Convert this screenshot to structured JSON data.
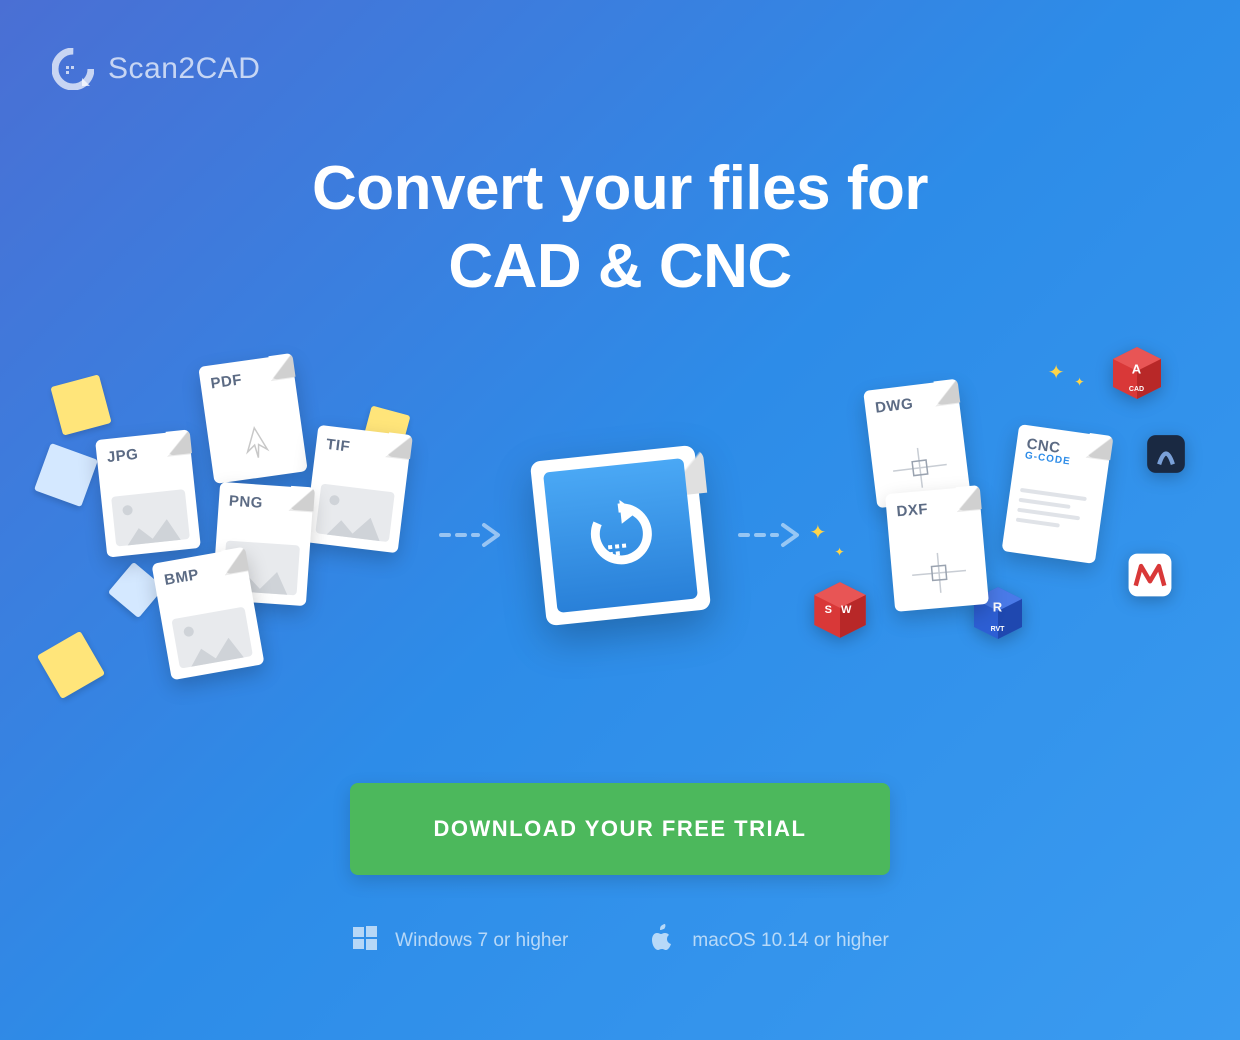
{
  "logo": {
    "text": "Scan2CAD"
  },
  "headline": "Convert your files for\nCAD & CNC",
  "input_files": [
    {
      "label": "PDF"
    },
    {
      "label": "TIF"
    },
    {
      "label": "JPG"
    },
    {
      "label": "PNG"
    },
    {
      "label": "BMP"
    }
  ],
  "output_files": [
    {
      "label": "DWG"
    },
    {
      "label": "DXF"
    },
    {
      "label": "CNC",
      "sub": "G-CODE"
    }
  ],
  "output_cubes": [
    {
      "label": "A",
      "sub": "CAD",
      "color": "#d93838"
    },
    {
      "label": "S W",
      "color": "#d93838"
    },
    {
      "label": "R",
      "sub": "RVT",
      "color": "#2d5fd4"
    }
  ],
  "cta": {
    "label": "DOWNLOAD YOUR FREE TRIAL"
  },
  "os": {
    "windows": "Windows 7 or higher",
    "mac": "macOS 10.14 or higher"
  }
}
